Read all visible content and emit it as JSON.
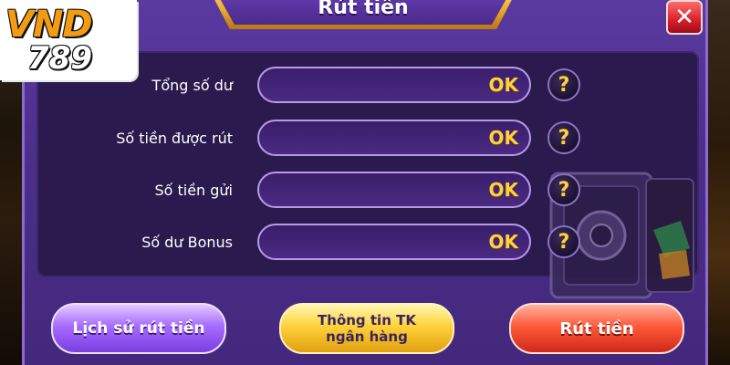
{
  "dialog": {
    "title": "Rút tiền",
    "close_label": "✕"
  },
  "logo": {
    "line1": "VND",
    "line2": "789"
  },
  "rows": [
    {
      "label": "Tổng số dư",
      "value": "OK",
      "help": "?"
    },
    {
      "label": "Số tiền được rút",
      "value": "OK",
      "help": "?"
    },
    {
      "label": "Số tiền gửi",
      "value": "OK",
      "help": "?"
    },
    {
      "label": "Số dư Bonus",
      "value": "OK",
      "help": "?"
    }
  ],
  "buttons": {
    "history": "Lịch sử rút tiền",
    "bank_info_line1": "Thông tin TK",
    "bank_info_line2": "ngân hàng",
    "withdraw": "Rút tiền"
  },
  "colors": {
    "dialog_purple": "#4d2f8c",
    "value_gold": "#ffd23a",
    "history_purple": "#a66bff",
    "bank_yellow": "#ffd23a",
    "withdraw_red": "#ff5a3a"
  }
}
